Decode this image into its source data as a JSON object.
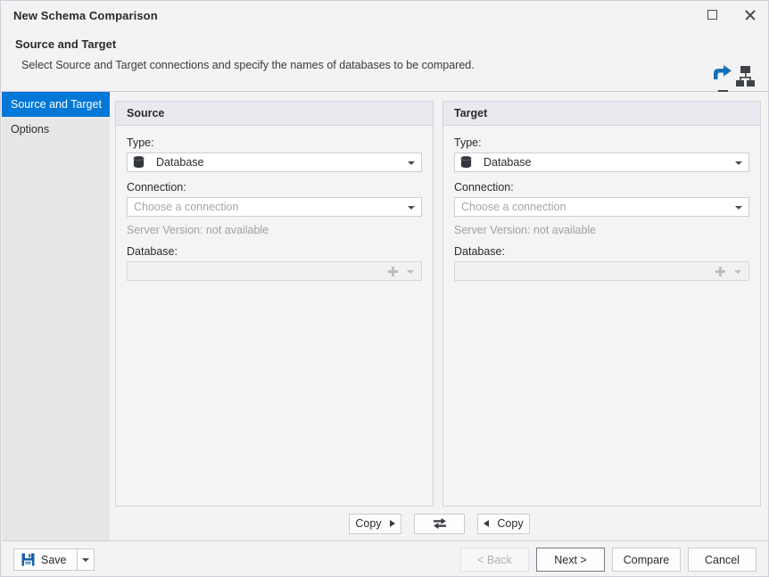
{
  "window": {
    "title": "New Schema Comparison",
    "maximize_icon": "maximize-icon",
    "close_icon": "close-icon"
  },
  "header": {
    "title": "Source and Target",
    "description": "Select Source and Target connections and specify the names of databases to be compared.",
    "artwork_icon": "schema-comparison-icon"
  },
  "sidebar": {
    "items": [
      {
        "label": "Source and Target",
        "selected": true
      },
      {
        "label": "Options",
        "selected": false
      }
    ]
  },
  "panels": {
    "source": {
      "heading": "Source",
      "type_label": "Type:",
      "type_value": "Database",
      "type_icon": "database-icon",
      "connection_label": "Connection:",
      "connection_placeholder": "Choose a connection",
      "server_version": "Server Version: not available",
      "database_label": "Database:",
      "database_value": "",
      "add_icon": "plus-icon",
      "dropdown_icon": "chevron-down-icon"
    },
    "target": {
      "heading": "Target",
      "type_label": "Type:",
      "type_value": "Database",
      "type_icon": "database-icon",
      "connection_label": "Connection:",
      "connection_placeholder": "Choose a connection",
      "server_version": "Server Version: not available",
      "database_label": "Database:",
      "database_value": "",
      "add_icon": "plus-icon",
      "dropdown_icon": "chevron-down-icon"
    }
  },
  "copy_row": {
    "copy_to_target_label": "Copy",
    "copy_to_target_icon": "arrow-right-icon",
    "swap_icon": "swap-arrows-icon",
    "copy_to_source_label": "Copy",
    "copy_to_source_icon": "arrow-left-icon"
  },
  "footer": {
    "save_label": "Save",
    "save_icon": "save-disk-icon",
    "save_dropdown_icon": "chevron-down-icon",
    "back_label": "< Back",
    "next_label": "Next >",
    "compare_label": "Compare",
    "cancel_label": "Cancel"
  },
  "colors": {
    "accent": "#0078d7",
    "window_bg": "#f3f3f3",
    "sidebar_bg": "#e7e7e7",
    "panel_header_bg": "#e9e9ef",
    "border": "#d3d3de",
    "disabled_text": "#a0a0a8",
    "save_icon_blue": "#1b5fa8"
  }
}
